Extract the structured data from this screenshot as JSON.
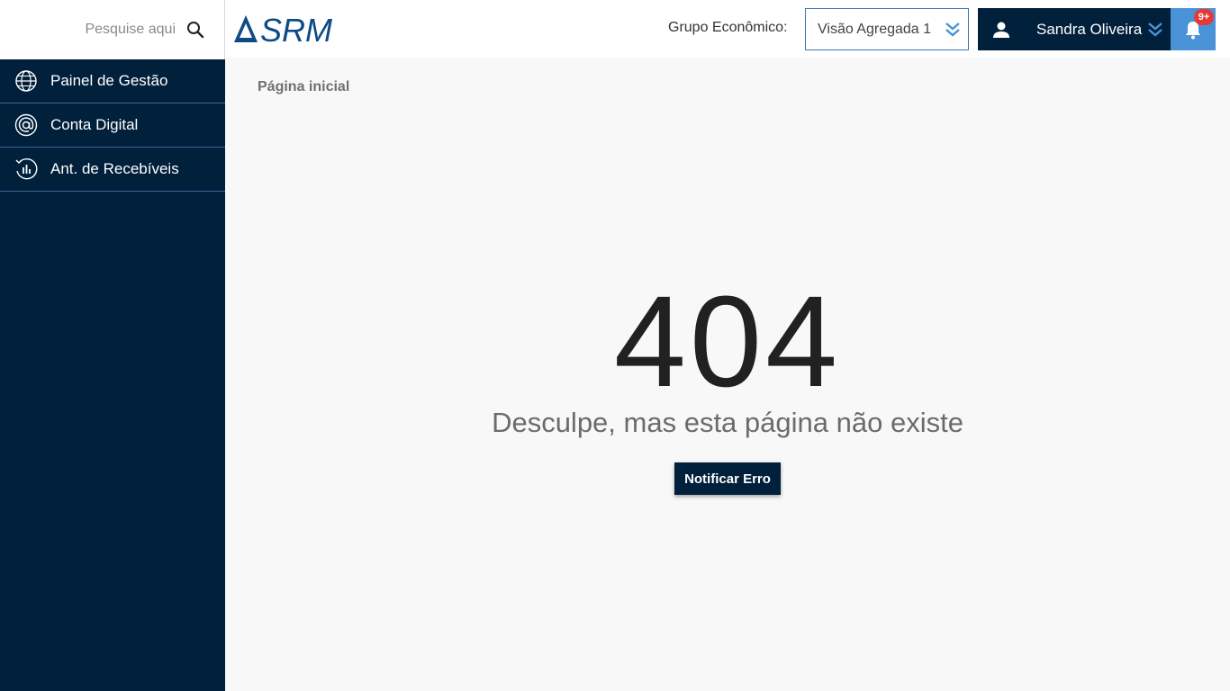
{
  "search": {
    "placeholder": "Pesquise aqui",
    "icon": "search-icon"
  },
  "sidebar": {
    "items": [
      {
        "label": "Painel de Gestão",
        "icon": "globe-icon"
      },
      {
        "label": "Conta Digital",
        "icon": "at-sign-icon"
      },
      {
        "label": "Ant. de Recebíveis",
        "icon": "history-chart-icon"
      }
    ]
  },
  "header": {
    "logo_text": "SRM",
    "group_label": "Grupo Econômico:",
    "group_value": "Visão Agregada 1",
    "user_name": "Sandra Oliveira",
    "notification_badge": "9+"
  },
  "main": {
    "breadcrumb": "Página inicial",
    "error_code": "404",
    "error_message": "Desculpe, mas esta página não existe",
    "notify_button": "Notificar Erro"
  },
  "colors": {
    "navy": "#00203b",
    "accent_blue": "#4a93d6",
    "badge_red": "#e53935",
    "background": "#f8f8f8"
  }
}
